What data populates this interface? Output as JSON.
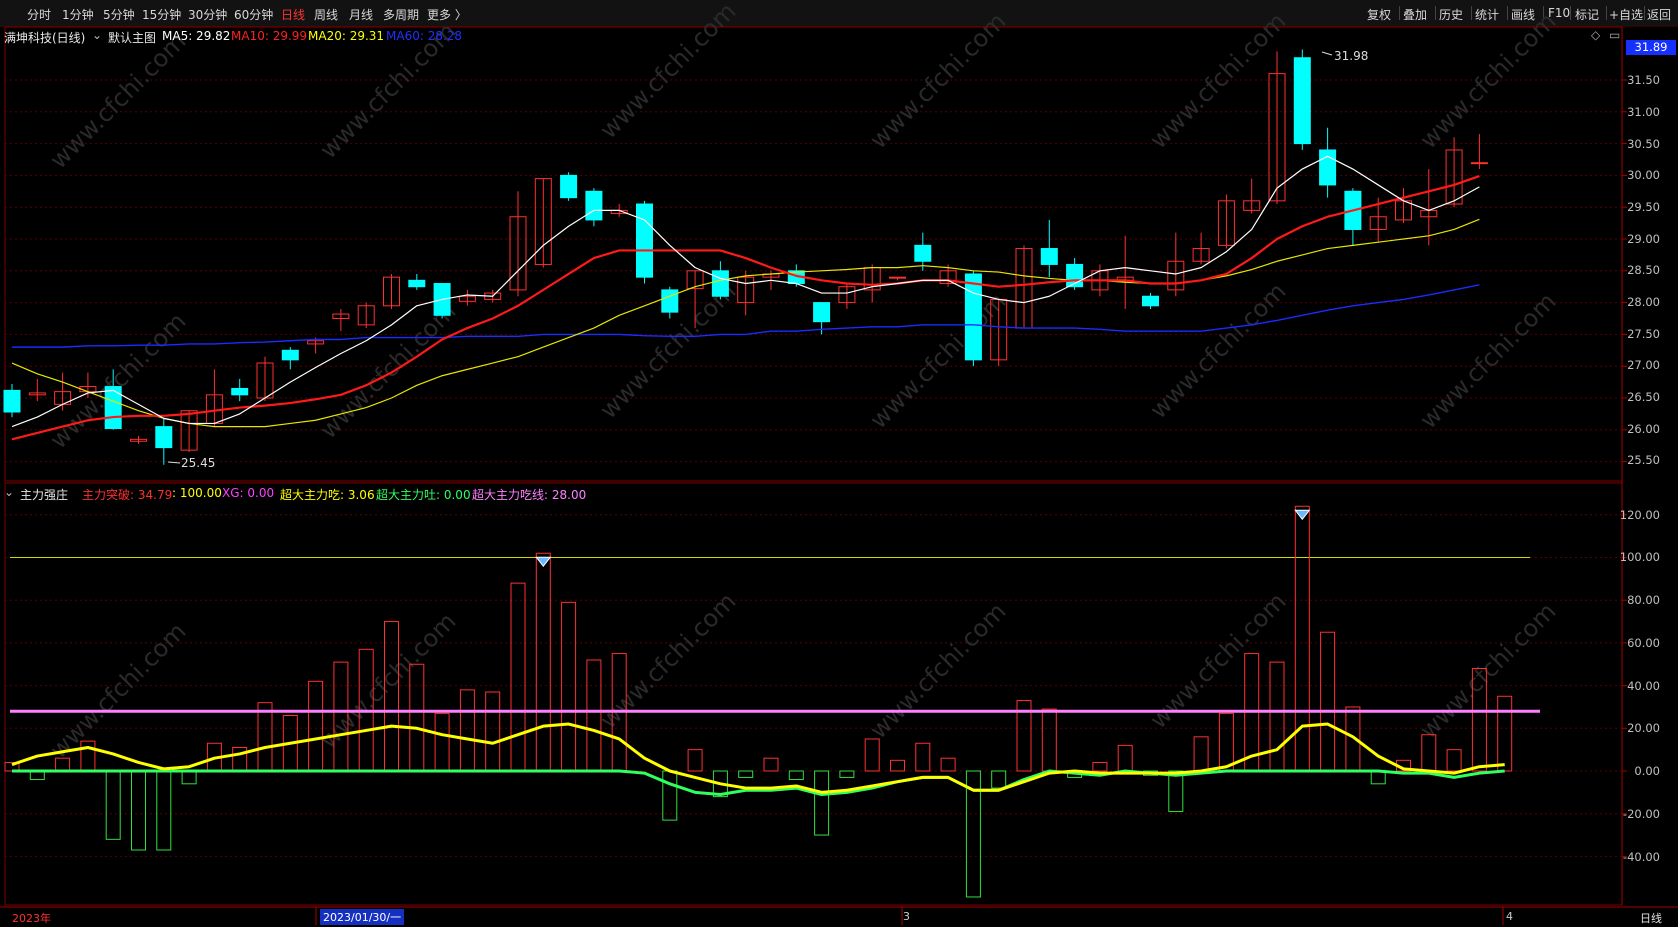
{
  "periods": [
    "分时",
    "1分钟",
    "5分钟",
    "15分钟",
    "30分钟",
    "60分钟",
    "日线",
    "周线",
    "月线",
    "多周期",
    "更多 〉"
  ],
  "active_period": "日线",
  "tools": [
    "复权",
    "叠加",
    "历史",
    "统计",
    "画线",
    "F10",
    "标记",
    "+自选",
    "返回"
  ],
  "main": {
    "stock_title": "满坤科技(日线)",
    "template": "默认主图",
    "ma_labels": [
      {
        "text": "MA5: 29.82",
        "color": "#ffffff"
      },
      {
        "text": "MA10: 29.99",
        "color": "#ff2020"
      },
      {
        "text": "MA20: 29.31",
        "color": "#ffff00"
      },
      {
        "text": "MA60: 28.28",
        "color": "#2030ff"
      }
    ],
    "current_price": "31.89",
    "high_marker": "31.98",
    "low_marker": "25.45",
    "y_ticks": [
      "31.50",
      "31.00",
      "30.50",
      "30.00",
      "29.50",
      "29.00",
      "28.50",
      "28.00",
      "27.50",
      "27.00",
      "26.50",
      "26.00",
      "25.50"
    ]
  },
  "indicator": {
    "name": "主力强庄",
    "labels": [
      {
        "text": "主力突破: 34.79",
        "color": "#ff3030"
      },
      {
        "text": ": 100.00",
        "color": "#ffff00"
      },
      {
        "text": "XG: 0.00",
        "color": "#ff40ff"
      },
      {
        "text": "超大主力吃: 3.06",
        "color": "#ffff00"
      },
      {
        "text": "超大主力吐: 0.00",
        "color": "#30ff60"
      },
      {
        "text": "超大主力吃线: 28.00",
        "color": "#ff80ff"
      }
    ],
    "y_ticks": [
      "120.00",
      "100.00",
      "80.00",
      "60.00",
      "40.00",
      "20.00",
      "0.00",
      "-20.00",
      "-40.00"
    ]
  },
  "x_axis": [
    "2023年",
    "2023/01/30/一",
    "3",
    "4"
  ],
  "bottom_right": "日线",
  "watermark": "www.cfchi.com",
  "chart_data": {
    "type": "candlestick",
    "candles": [
      [
        26.62,
        26.28,
        26.72,
        26.2
      ],
      [
        26.55,
        26.58,
        26.8,
        26.45
      ],
      [
        26.4,
        26.6,
        26.9,
        26.3
      ],
      [
        26.6,
        26.68,
        26.9,
        26.5
      ],
      [
        26.68,
        26.02,
        26.95,
        26.0
      ],
      [
        25.82,
        25.85,
        25.9,
        25.78
      ],
      [
        26.05,
        25.72,
        26.18,
        25.45
      ],
      [
        25.68,
        26.3,
        26.3,
        25.65
      ],
      [
        26.1,
        26.55,
        26.95,
        26.05
      ],
      [
        26.65,
        26.55,
        26.8,
        26.45
      ],
      [
        26.5,
        27.05,
        27.15,
        26.45
      ],
      [
        27.25,
        27.1,
        27.3,
        26.95
      ],
      [
        27.35,
        27.4,
        27.45,
        27.2
      ],
      [
        27.75,
        27.82,
        27.9,
        27.55
      ],
      [
        27.65,
        27.95,
        28.0,
        27.6
      ],
      [
        27.95,
        28.4,
        28.45,
        27.9
      ],
      [
        28.35,
        28.25,
        28.45,
        28.2
      ],
      [
        28.3,
        27.8,
        28.3,
        27.75
      ],
      [
        28.02,
        28.1,
        28.2,
        27.95
      ],
      [
        28.05,
        28.15,
        28.2,
        28.0
      ],
      [
        28.2,
        29.35,
        29.75,
        28.1
      ],
      [
        28.6,
        29.95,
        29.95,
        28.55
      ],
      [
        30.0,
        29.65,
        30.05,
        29.6
      ],
      [
        29.75,
        29.3,
        29.8,
        29.2
      ],
      [
        29.4,
        29.45,
        29.55,
        29.35
      ],
      [
        29.55,
        28.4,
        29.6,
        28.3
      ],
      [
        28.2,
        27.85,
        28.25,
        27.75
      ],
      [
        28.22,
        28.5,
        28.5,
        27.6
      ],
      [
        28.5,
        28.1,
        28.65,
        28.05
      ],
      [
        28.0,
        28.4,
        28.5,
        27.8
      ],
      [
        28.4,
        28.45,
        28.5,
        28.2
      ],
      [
        28.5,
        28.3,
        28.6,
        28.25
      ],
      [
        28.0,
        27.7,
        28.0,
        27.5
      ],
      [
        28.0,
        28.25,
        28.3,
        27.9
      ],
      [
        28.2,
        28.55,
        28.6,
        28.0
      ],
      [
        28.4,
        28.4,
        28.4,
        28.35
      ],
      [
        28.9,
        28.65,
        29.1,
        28.5
      ],
      [
        28.3,
        28.5,
        28.6,
        28.25
      ],
      [
        28.45,
        27.1,
        28.5,
        27.0
      ],
      [
        27.1,
        28.05,
        28.05,
        27.0
      ],
      [
        27.6,
        28.85,
        28.9,
        27.6
      ],
      [
        28.85,
        28.6,
        29.3,
        28.4
      ],
      [
        28.6,
        28.25,
        28.7,
        28.2
      ],
      [
        28.2,
        28.5,
        28.6,
        28.1
      ],
      [
        28.35,
        28.4,
        29.05,
        27.9
      ],
      [
        28.1,
        27.95,
        28.15,
        27.9
      ],
      [
        28.2,
        28.65,
        29.1,
        28.1
      ],
      [
        28.65,
        28.85,
        29.1,
        28.6
      ],
      [
        28.9,
        29.6,
        29.7,
        28.85
      ],
      [
        29.45,
        29.6,
        29.95,
        29.4
      ],
      [
        29.6,
        31.6,
        31.95,
        29.55
      ],
      [
        31.85,
        30.5,
        31.98,
        30.4
      ],
      [
        30.4,
        29.85,
        30.75,
        29.65
      ],
      [
        29.75,
        29.15,
        29.8,
        28.9
      ],
      [
        29.15,
        29.35,
        29.65,
        28.95
      ],
      [
        29.3,
        29.6,
        29.8,
        29.25
      ],
      [
        29.35,
        29.45,
        30.1,
        28.9
      ],
      [
        29.55,
        30.4,
        30.6,
        29.5
      ],
      [
        30.2,
        30.2,
        30.65,
        30.1
      ]
    ],
    "ma5": [
      26.05,
      26.2,
      26.4,
      26.58,
      26.62,
      26.4,
      26.18,
      26.1,
      26.1,
      26.25,
      26.5,
      26.75,
      26.98,
      27.2,
      27.4,
      27.65,
      27.95,
      28.05,
      28.12,
      28.1,
      28.5,
      28.9,
      29.2,
      29.45,
      29.45,
      29.3,
      28.9,
      28.55,
      28.38,
      28.3,
      28.35,
      28.3,
      28.15,
      28.15,
      28.25,
      28.3,
      28.35,
      28.35,
      28.15,
      28.05,
      28.0,
      28.1,
      28.3,
      28.5,
      28.55,
      28.5,
      28.45,
      28.55,
      28.8,
      29.15,
      29.8,
      30.1,
      30.3,
      30.1,
      29.85,
      29.6,
      29.45,
      29.6,
      29.82
    ],
    "ma10": [
      25.85,
      25.95,
      26.05,
      26.15,
      26.2,
      26.22,
      26.22,
      26.25,
      26.3,
      26.35,
      26.38,
      26.42,
      26.48,
      26.55,
      26.7,
      26.9,
      27.15,
      27.42,
      27.6,
      27.75,
      27.95,
      28.2,
      28.45,
      28.7,
      28.82,
      28.82,
      28.82,
      28.82,
      28.82,
      28.7,
      28.55,
      28.42,
      28.35,
      28.3,
      28.28,
      28.3,
      28.35,
      28.35,
      28.3,
      28.25,
      28.28,
      28.32,
      28.35,
      28.35,
      28.35,
      28.3,
      28.3,
      28.35,
      28.45,
      28.7,
      29.0,
      29.2,
      29.35,
      29.45,
      29.55,
      29.65,
      29.75,
      29.85,
      29.99
    ],
    "ma20": [
      27.05,
      26.88,
      26.75,
      26.6,
      26.45,
      26.3,
      26.18,
      26.1,
      26.05,
      26.05,
      26.05,
      26.1,
      26.15,
      26.25,
      26.35,
      26.5,
      26.7,
      26.85,
      26.95,
      27.05,
      27.15,
      27.3,
      27.45,
      27.6,
      27.8,
      27.95,
      28.1,
      28.25,
      28.35,
      28.42,
      28.45,
      28.48,
      28.5,
      28.52,
      28.55,
      28.55,
      28.58,
      28.55,
      28.5,
      28.48,
      28.42,
      28.38,
      28.35,
      28.35,
      28.32,
      28.3,
      28.3,
      28.35,
      28.42,
      28.52,
      28.65,
      28.75,
      28.85,
      28.9,
      28.95,
      29.0,
      29.05,
      29.15,
      29.31
    ],
    "ma60": [
      27.3,
      27.3,
      27.3,
      27.32,
      27.32,
      27.33,
      27.33,
      27.35,
      27.35,
      27.37,
      27.38,
      27.4,
      27.42,
      27.42,
      27.45,
      27.45,
      27.45,
      27.45,
      27.47,
      27.47,
      27.47,
      27.5,
      27.5,
      27.5,
      27.5,
      27.48,
      27.47,
      27.47,
      27.5,
      27.5,
      27.55,
      27.55,
      27.58,
      27.6,
      27.62,
      27.62,
      27.65,
      27.65,
      27.65,
      27.62,
      27.6,
      27.6,
      27.6,
      27.58,
      27.55,
      27.55,
      27.55,
      27.55,
      27.6,
      27.65,
      27.72,
      27.8,
      27.88,
      27.95,
      28.0,
      28.05,
      28.12,
      28.2,
      28.28
    ],
    "ind_bars": [
      4,
      -4,
      6,
      14,
      -32,
      -37,
      -37,
      -6,
      13,
      11,
      32,
      26,
      42,
      51,
      57,
      70,
      50,
      27,
      38,
      37,
      88,
      102,
      79,
      52,
      55,
      0,
      -23,
      10,
      -12,
      -3,
      6,
      -4,
      -30,
      -3,
      15,
      5,
      13,
      6,
      -59,
      -8,
      33,
      29,
      -3,
      4,
      12,
      -2,
      -19,
      16,
      27,
      55,
      51,
      124,
      65,
      30,
      -6,
      5,
      17,
      10,
      48,
      35
    ],
    "ind_line": [
      3,
      7,
      9,
      11,
      8,
      4,
      1,
      2,
      6,
      8,
      11,
      13,
      15,
      17,
      19,
      21,
      20,
      17,
      15,
      13,
      17,
      21,
      22,
      19,
      15,
      6,
      0,
      -3,
      -6,
      -8,
      -8,
      -7,
      -10,
      -9,
      -7,
      -5,
      -3,
      -3,
      -9,
      -9,
      -5,
      -1,
      0,
      -1,
      -1,
      -1,
      -1,
      0,
      2,
      7,
      10,
      21,
      22,
      16,
      7,
      1,
      0,
      -1,
      2,
      3
    ],
    "ind_green": [
      0,
      0,
      0,
      0,
      0,
      0,
      0,
      0,
      0,
      0,
      0,
      0,
      0,
      0,
      0,
      0,
      0,
      0,
      0,
      0,
      0,
      0,
      0,
      0,
      0,
      -1,
      -6,
      -10,
      -11,
      -9,
      -9,
      -8,
      -11,
      -10,
      -8,
      -5,
      -3,
      -3,
      -9,
      -9,
      -4,
      0,
      -1,
      -2,
      0,
      -1,
      -2,
      -1,
      0,
      0,
      0,
      0,
      0,
      0,
      0,
      -1,
      -1,
      -3,
      -1,
      0
    ],
    "ref_line_100": 100,
    "ref_line_28": 28
  }
}
